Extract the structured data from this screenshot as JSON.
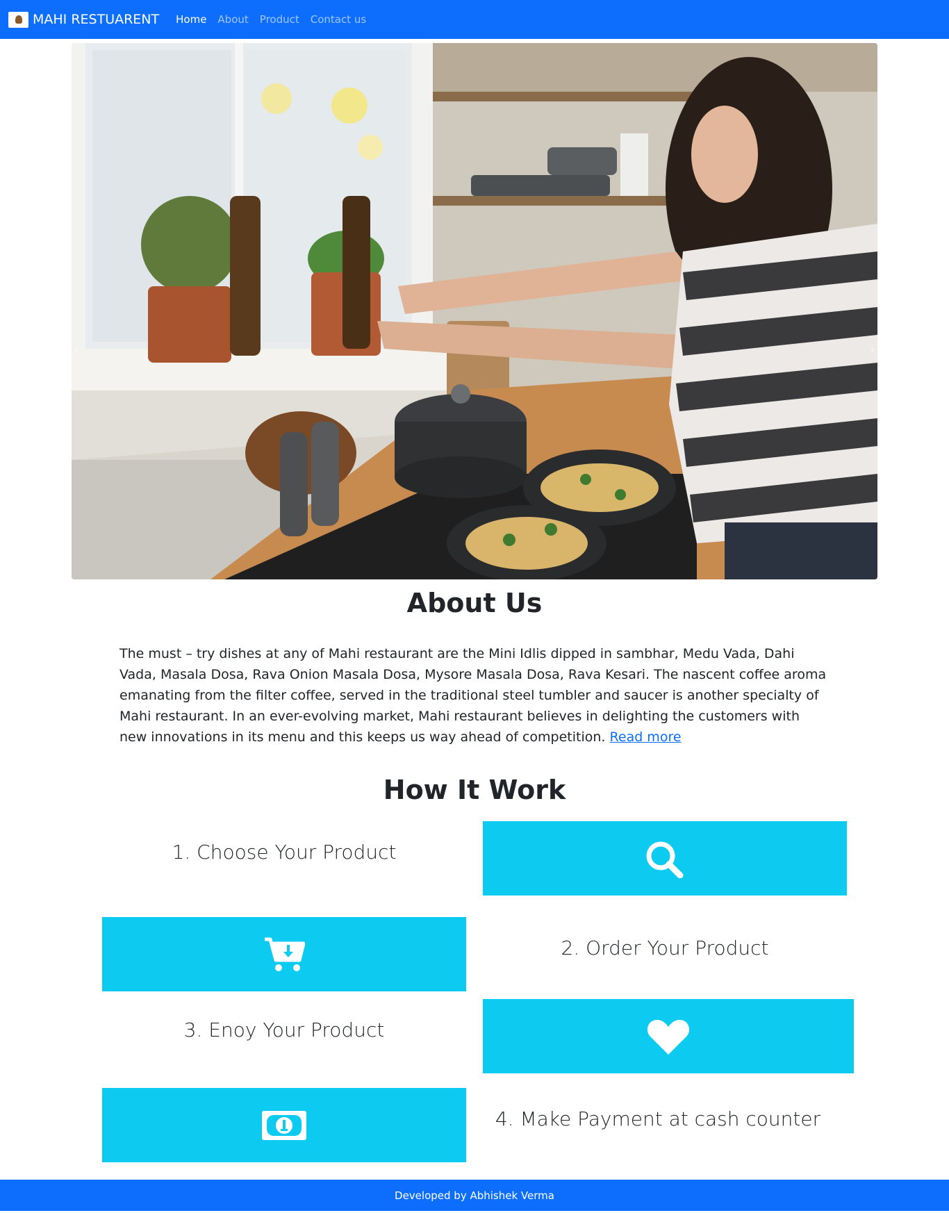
{
  "navbar": {
    "brand": "MAHI RESTUARENT",
    "links": [
      {
        "label": "Home",
        "active": true
      },
      {
        "label": "About",
        "active": false
      },
      {
        "label": "Product",
        "active": false
      },
      {
        "label": "Contact us",
        "active": false
      }
    ]
  },
  "hero": {
    "carousel_prev": "‹",
    "carousel_next": "›"
  },
  "about": {
    "title": "About Us",
    "body": "The must – try dishes at any of Mahi restaurant are the Mini Idlis dipped in sambhar, Medu Vada, Dahi Vada, Masala Dosa, Rava Onion Masala Dosa, Mysore Masala Dosa, Rava Kesari. The nascent coffee aroma emanating from the filter coffee, served in the traditional steel tumbler and saucer is another specialty of Mahi restaurant. In an ever-evolving market, Mahi restaurant believes in delighting the customers with new innovations in its menu and this keeps us way ahead of competition.",
    "read_more": "Read more"
  },
  "how": {
    "title": "How It Work",
    "steps": [
      {
        "label": "1. Choose Your Product",
        "icon": "search-icon"
      },
      {
        "label": "2. Order Your Product",
        "icon": "cart-download-icon"
      },
      {
        "label": "3. Enoy Your Product",
        "icon": "heart-icon"
      },
      {
        "label": "4. Make Payment at cash counter",
        "icon": "money-bill-icon"
      }
    ]
  },
  "footer": {
    "text": "Developed by Abhishek Verma"
  },
  "colors": {
    "primary": "#0d6efd",
    "info": "#0dcaf0"
  }
}
